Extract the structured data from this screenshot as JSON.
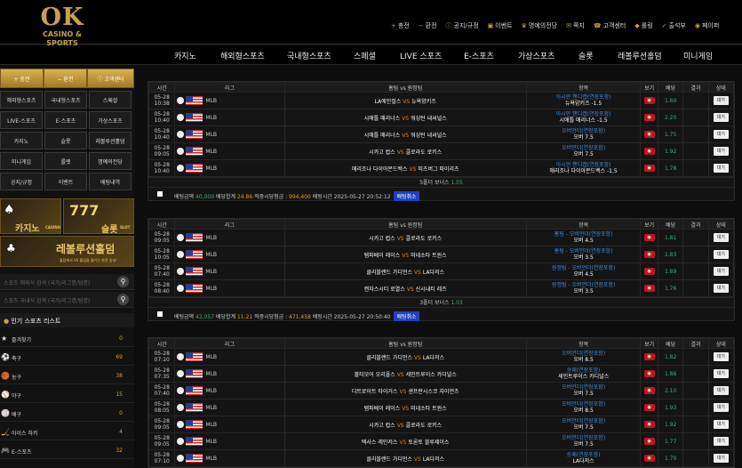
{
  "brand": {
    "logo_big": "OK",
    "logo_small": "CASINO & SPORTS"
  },
  "topmenu": [
    {
      "icon": "+",
      "label": "충전"
    },
    {
      "icon": "−",
      "label": "환전"
    },
    {
      "icon": "ⓘ",
      "label": "공지/규정"
    },
    {
      "icon": "▣",
      "label": "이벤트"
    },
    {
      "icon": "♛",
      "label": "명예의전당"
    },
    {
      "icon": "✉",
      "label": "쪽지"
    },
    {
      "icon": "☎",
      "label": "고객센터"
    },
    {
      "icon": "◆",
      "label": "롤링"
    },
    {
      "icon": "✓",
      "label": "출석부"
    },
    {
      "icon": "◉",
      "label": "페이퍼"
    }
  ],
  "nav": [
    "카지노",
    "해외형스포츠",
    "국내형스포츠",
    "스페셜",
    "LIVE 스포츠",
    "E-스포츠",
    "가상스포츠",
    "슬롯",
    "레볼루션홀덤",
    "미니게임"
  ],
  "sidebar": {
    "top_buttons": [
      "+ 충전",
      "− 환전",
      "ⓘ 고객센터"
    ],
    "grid": [
      "해외형스포츠",
      "국내형스포츠",
      "스페셜",
      "LIVE-스포츠",
      "E-스포츠",
      "가상스포츠",
      "카지노",
      "슬롯",
      "레볼루션홀덤",
      "미니게임",
      "룰렛",
      "명예의전당",
      "공지/규정",
      "이벤트",
      "배팅내역"
    ],
    "banner_casino": "카지노",
    "banner_casino_sub": "CASINO",
    "banner_slot": "슬롯",
    "banner_slot_sub": "SLOT",
    "banner_slot_num": "777",
    "banner_holdem": "레볼루션홀덤",
    "banner_holdem_sub": "홀덤에서 VS 홀덤을 즐기는 완전 승부!",
    "search1": "스포츠 해외식 검색 (국가/리그명/팀명)",
    "search2": "스포츠 국내식 검색 (국가/리그명/팀명)",
    "popular_title": "인기 스포츠 리스트",
    "sports": [
      {
        "icon": "★",
        "name": "즐겨찾기",
        "count": "0"
      },
      {
        "icon": "⚽",
        "name": "축구",
        "count": "69"
      },
      {
        "icon": "🏀",
        "name": "농구",
        "count": "38"
      },
      {
        "icon": "⚾",
        "name": "야구",
        "count": "15"
      },
      {
        "icon": "🏐",
        "name": "배구",
        "count": "0"
      },
      {
        "icon": "🏒",
        "name": "아이스 하키",
        "count": "4"
      },
      {
        "icon": "🎮",
        "name": "E-스포츠",
        "count": "32"
      }
    ]
  },
  "table_headers": [
    "시간",
    "리그",
    "홈팀 vs 원정팀",
    "항목",
    "보기",
    "배당",
    "결과",
    "상태"
  ],
  "league": "MLB",
  "vs": "VS",
  "detail": "대기",
  "panels": [
    {
      "rows": [
        {
          "date": "05-28",
          "time": "10:38",
          "home": "LA에인절스",
          "away": "뉴욕양키즈",
          "p1": "아시안 핸디캡(연장포함)",
          "p2": "뉴욕양키즈 -1.5",
          "odds": "1.60"
        },
        {
          "date": "05-28",
          "time": "10:40",
          "home": "시애틀 매리너스",
          "away": "워싱턴 내셔널스",
          "p1": "아시안 핸디캡(연장포함)",
          "p2": "시애틀 매리너스 -1.5",
          "odds": "2.20"
        },
        {
          "date": "05-28",
          "time": "10:40",
          "home": "시애틀 매리너스",
          "away": "워싱턴 내셔널스",
          "p1": "오버언더(연장포함)",
          "p2": "오버 7.5",
          "odds": "1.75"
        },
        {
          "date": "05-28",
          "time": "09:05",
          "home": "시카고 컵스",
          "away": "콜로라도 로키스",
          "p1": "오버언더(연장포함)",
          "p2": "오버 7.5",
          "odds": "1.92"
        },
        {
          "date": "05-28",
          "time": "10:40",
          "home": "애리조나 다이아몬드백스",
          "away": "피츠버그 파이리츠",
          "p1": "아시안 핸디캡(연장포함)",
          "p2": "애리조나 다이아몬드백스 -1.5",
          "odds": "1.78"
        }
      ],
      "bonus_label": "5폴더 보너스",
      "bonus_value": "1.05",
      "sum": {
        "bet_label": "배팅금액",
        "bet": "40,000",
        "odds_label": "배당합계",
        "odds": "24.86",
        "win_label": "적중시당첨금 :",
        "win": "994,400",
        "time_label": "배팅시간",
        "time": "2025-05-27 20:52:12",
        "cancel": "배팅취소"
      }
    },
    {
      "rows": [
        {
          "date": "05-28",
          "time": "09:05",
          "home": "시카고 컵스",
          "away": "콜로라도 로키스",
          "p1": "홈팀 - 오버언더(연장포함)",
          "p2": "오버 4.5",
          "odds": "1.81"
        },
        {
          "date": "05-28",
          "time": "10:05",
          "home": "탬파베이 레이스",
          "away": "미네소타 트윈스",
          "p1": "홈팀 - 오버언더(연장포함)",
          "p2": "오버 3.5",
          "odds": "1.83"
        },
        {
          "date": "05-28",
          "time": "07:40",
          "home": "클리블랜드 가디언스",
          "away": "LA다저스",
          "p1": "원정팀 - 오버언더(연장포함)",
          "p2": "오버 4.5",
          "odds": "1.89"
        },
        {
          "date": "05-28",
          "time": "08:40",
          "home": "캔자스시티 로열스",
          "away": "신시내티 레즈",
          "p1": "원정팀 - 오버언더(연장포함)",
          "p2": "오버 3.5",
          "odds": "1.76"
        }
      ],
      "bonus_label": "3폴더 보너스",
      "bonus_value": "1.03",
      "sum": {
        "bet_label": "배팅금액",
        "bet": "42,057",
        "odds_label": "배당합계",
        "odds": "11.21",
        "win_label": "적중시당첨금 :",
        "win": "471,458",
        "time_label": "배팅시간",
        "time": "2025-05-27 20:50:40",
        "cancel": "배팅취소"
      }
    },
    {
      "rows": [
        {
          "date": "05-28",
          "time": "07:10",
          "home": "클리블랜드 가디언스",
          "away": "LA다저스",
          "p1": "오버언더(연장포함)",
          "p2": "오버 8.5",
          "odds": "1.82"
        },
        {
          "date": "05-28",
          "time": "07:35",
          "home": "볼티모어 오리올스",
          "away": "세인트루이스 카디널스",
          "p1": "승패(연장포함)",
          "p2": "세인트루이스 카디널스",
          "odds": "1.86"
        },
        {
          "date": "05-28",
          "time": "07:40",
          "home": "디트로이트 타이거스",
          "away": "샌프란시스코 자이언츠",
          "p1": "오버언더(연장포함)",
          "p2": "오버 7.5",
          "odds": "2.10"
        },
        {
          "date": "05-28",
          "time": "08:05",
          "home": "탬파베이 레이스",
          "away": "미네소타 트윈스",
          "p1": "오버언더(연장포함)",
          "p2": "오버 8.5",
          "odds": "1.93"
        },
        {
          "date": "05-28",
          "time": "09:05",
          "home": "시카고 컵스",
          "away": "콜로라도 로키스",
          "p1": "오버언더(연장포함)",
          "p2": "오버 7.5",
          "odds": "1.92"
        },
        {
          "date": "05-28",
          "time": "09:05",
          "home": "텍사스 레인저스",
          "away": "토론토 블루제이스",
          "p1": "오버언더(연장포함)",
          "p2": "오버 7.5",
          "odds": "1.77"
        },
        {
          "date": "05-28",
          "time": "07:10",
          "home": "클리블랜드 가디언스",
          "away": "LA다저스",
          "p1": "승패(연장포함)",
          "p2": "LA다저스",
          "odds": "1.70"
        }
      ]
    }
  ]
}
